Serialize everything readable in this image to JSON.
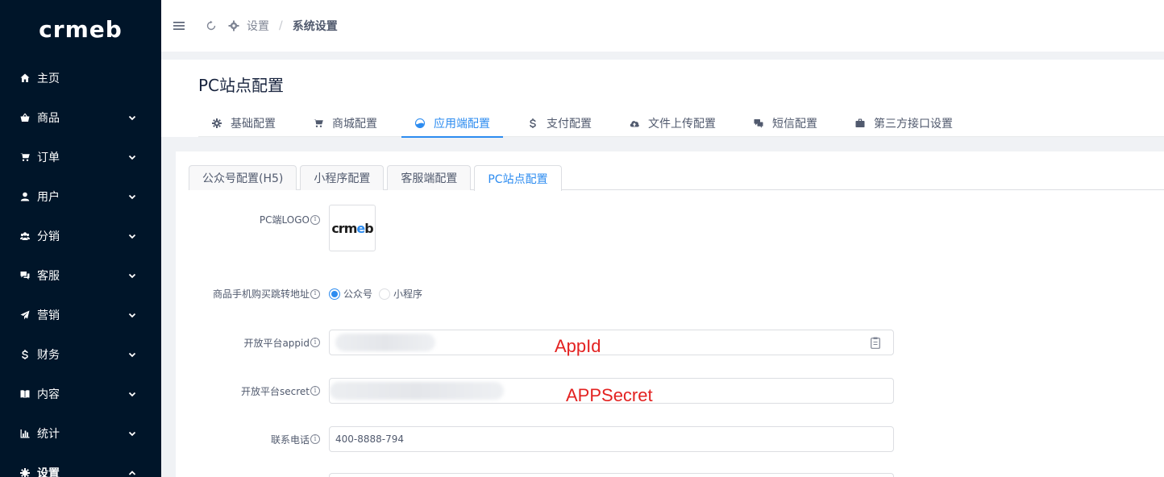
{
  "logo": {
    "text_a": "crm",
    "text_e": "e",
    "text_b": "b"
  },
  "sidebar": {
    "items": [
      {
        "label": "主页",
        "icon": "home-icon",
        "chevron": ""
      },
      {
        "label": "商品",
        "icon": "basket-icon",
        "chevron": "down"
      },
      {
        "label": "订单",
        "icon": "cart-icon",
        "chevron": "down"
      },
      {
        "label": "用户",
        "icon": "user-icon",
        "chevron": "down"
      },
      {
        "label": "分销",
        "icon": "users-icon",
        "chevron": "down"
      },
      {
        "label": "客服",
        "icon": "chat-icon",
        "chevron": "down"
      },
      {
        "label": "营销",
        "icon": "send-icon",
        "chevron": "down"
      },
      {
        "label": "财务",
        "icon": "dollar-icon",
        "chevron": "down"
      },
      {
        "label": "内容",
        "icon": "book-icon",
        "chevron": "down"
      },
      {
        "label": "统计",
        "icon": "bar-chart-icon",
        "chevron": "down"
      },
      {
        "label": "设置",
        "icon": "gear-icon",
        "chevron": "up"
      }
    ]
  },
  "breadcrumb": {
    "parent": "设置",
    "sep": "/",
    "current": "系统设置"
  },
  "page": {
    "title": "PC站点配置"
  },
  "main_tabs": [
    {
      "label": "基础配置",
      "icon": "gear-icon",
      "active": false
    },
    {
      "label": "商城配置",
      "icon": "cart-icon",
      "active": false
    },
    {
      "label": "应用端配置",
      "icon": "app-icon",
      "active": true
    },
    {
      "label": "支付配置",
      "icon": "dollar-icon",
      "active": false
    },
    {
      "label": "文件上传配置",
      "icon": "cloud-upload-icon",
      "active": false
    },
    {
      "label": "短信配置",
      "icon": "sms-icon",
      "active": false
    },
    {
      "label": "第三方接口设置",
      "icon": "briefcase-icon",
      "active": false
    }
  ],
  "sub_tabs": [
    {
      "label": "公众号配置(H5)",
      "active": false
    },
    {
      "label": "小程序配置",
      "active": false
    },
    {
      "label": "客服端配置",
      "active": false
    },
    {
      "label": "PC站点配置",
      "active": true
    }
  ],
  "form": {
    "logo_label": "PC端LOGO",
    "jump_label": "商品手机购买跳转地址",
    "jump_options": [
      {
        "label": "公众号",
        "checked": true
      },
      {
        "label": "小程序",
        "checked": false
      }
    ],
    "appid_label": "开放平台appid",
    "secret_label": "开放平台secret",
    "phone_label": "联系电话",
    "phone_value": "400-8888-794",
    "info_glyph": "i"
  },
  "annotations": {
    "appid": "AppId",
    "secret": "APPSecret"
  },
  "colors": {
    "sidebar_bg": "#001529",
    "accent": "#2d8cf0",
    "annotation": "#e32221"
  }
}
